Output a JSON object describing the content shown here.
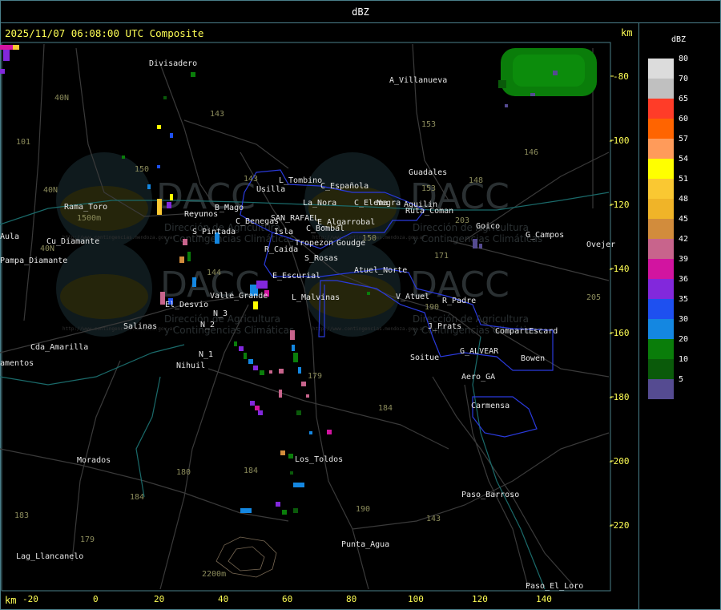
{
  "header": {
    "title": "dBZ"
  },
  "map": {
    "timestamp": "2025/11/07 06:08:00 UTC Composite",
    "unit_top": "km",
    "unit_bottom": "km",
    "y_ticks": [
      "-80",
      "-100",
      "-120",
      "-140",
      "-160",
      "-180",
      "-200",
      "-220"
    ],
    "x_ticks": [
      "-20",
      "0",
      "20",
      "40",
      "60",
      "80",
      "100",
      "120",
      "140"
    ],
    "watermark": {
      "brand": "DACC",
      "line1": "Dirección de Agricultura",
      "line2": "y Contingencias Climáticas",
      "url": "http://www.contingencias.mendoza.gov.ar"
    },
    "places": [
      "Divisadero",
      "A_Villanueva",
      "Guadales",
      "Usilla",
      "L_Tombino",
      "C_Española",
      "La_Nora",
      "C_Elena",
      "Negra",
      "Aguilin",
      "Ruta_Coman",
      "Rama_Toro",
      "Reyunos",
      "B_Mago",
      "C_Benegas",
      "SAN_RAFAEL",
      "E_Algarrobal",
      "C_Bombal",
      "S_Pintada",
      "Isla",
      "Tropezon",
      "Goudge",
      "Goico",
      "G_Campos",
      "Ovejer",
      "Pampa_Diamante",
      "Aula",
      "Cu_Diamante",
      "R_Caida",
      "S_Rosas",
      "Atuel_Norte",
      "E_Escurial",
      "Valle_Grande",
      "L_Malvinas",
      "V_Atuel",
      "R_Padre",
      "El_Desvio",
      "N_3",
      "Salinas",
      "N_2",
      "J_Prats",
      "CompartEscard",
      "Cda_Amarilla",
      "N_1",
      "G_ALVEAR",
      "Bowen",
      "amentos",
      "Nihuil",
      "Soitue",
      "Aero_GA",
      "Carmensa",
      "Morados",
      "Los_Toldos",
      "Paso_Barroso",
      "Punta_Agua",
      "Lag_Llancanelo",
      "Paso_El_Loro",
      "1500m",
      "2200m"
    ],
    "routes": [
      "40N",
      "40N",
      "40N",
      "101",
      "143",
      "153",
      "150",
      "146",
      "143",
      "148",
      "153",
      "203",
      "144",
      "150",
      "171",
      "190",
      "205",
      "179",
      "184",
      "180",
      "184",
      "184",
      "183",
      "179",
      "190",
      "143"
    ]
  },
  "legend": {
    "title": "dBZ",
    "items": [
      {
        "label": "80",
        "color": "#dcdcdc"
      },
      {
        "label": "70",
        "color": "#c0c0c0"
      },
      {
        "label": "65",
        "color": "#ff3c28"
      },
      {
        "label": "60",
        "color": "#ff6400"
      },
      {
        "label": "57",
        "color": "#ff9b5a"
      },
      {
        "label": "54",
        "color": "#ffff00"
      },
      {
        "label": "51",
        "color": "#fac832"
      },
      {
        "label": "48",
        "color": "#f0b428"
      },
      {
        "label": "45",
        "color": "#d28c3c"
      },
      {
        "label": "42",
        "color": "#c8648c"
      },
      {
        "label": "39",
        "color": "#d214a0"
      },
      {
        "label": "36",
        "color": "#8228dc"
      },
      {
        "label": "35",
        "color": "#1e50f0"
      },
      {
        "label": "30",
        "color": "#1487e1"
      },
      {
        "label": "20",
        "color": "#0a7d0a"
      },
      {
        "label": "10",
        "color": "#0a5a0a"
      },
      {
        "label": "5",
        "color": "#554b91"
      }
    ]
  }
}
